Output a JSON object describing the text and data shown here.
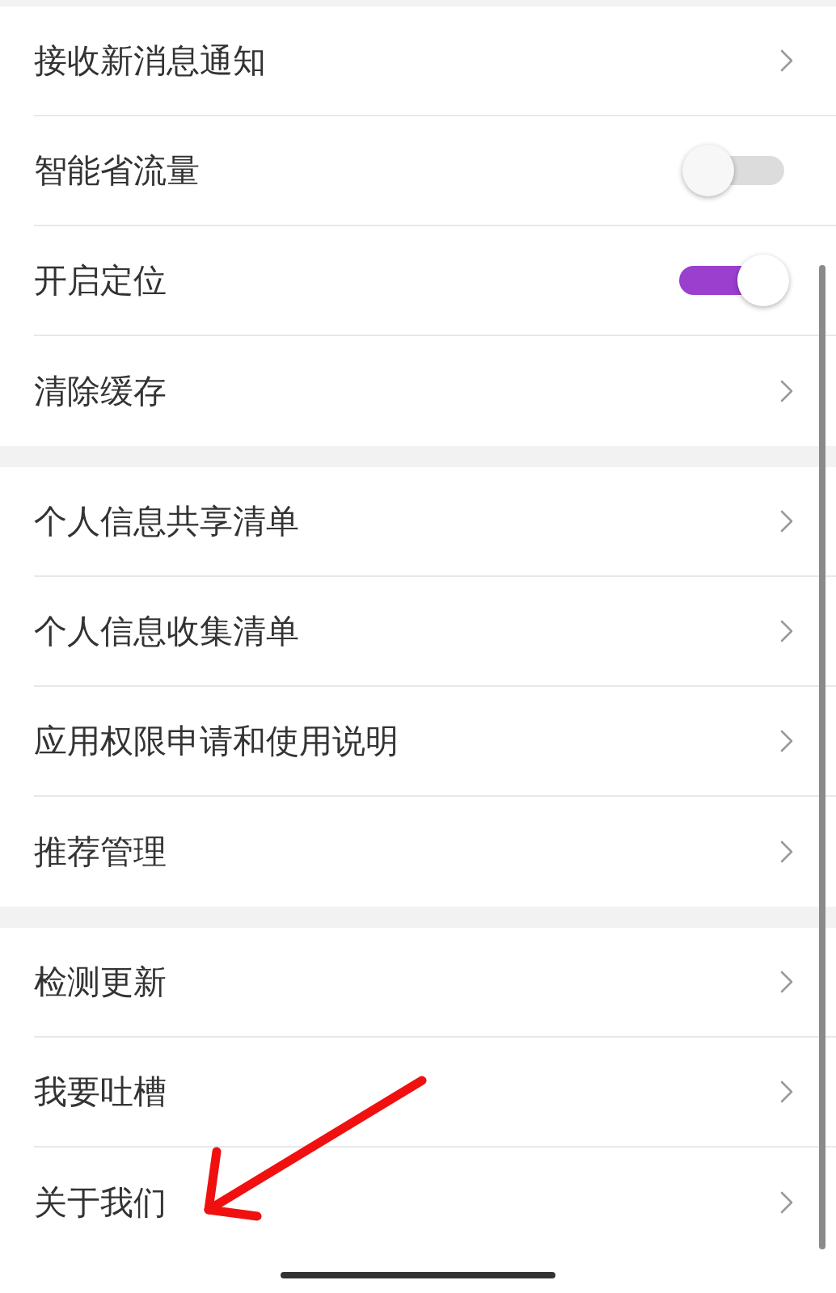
{
  "groups": [
    {
      "items": [
        {
          "label": "接收新消息通知",
          "kind": "link"
        },
        {
          "label": "智能省流量",
          "kind": "toggle",
          "on": false
        },
        {
          "label": "开启定位",
          "kind": "toggle",
          "on": true
        },
        {
          "label": "清除缓存",
          "kind": "link"
        }
      ]
    },
    {
      "items": [
        {
          "label": "个人信息共享清单",
          "kind": "link"
        },
        {
          "label": "个人信息收集清单",
          "kind": "link"
        },
        {
          "label": "应用权限申请和使用说明",
          "kind": "link"
        },
        {
          "label": "推荐管理",
          "kind": "link"
        }
      ]
    },
    {
      "items": [
        {
          "label": "检测更新",
          "kind": "link"
        },
        {
          "label": "我要吐槽",
          "kind": "link"
        },
        {
          "label": "关于我们",
          "kind": "link"
        }
      ]
    }
  ]
}
